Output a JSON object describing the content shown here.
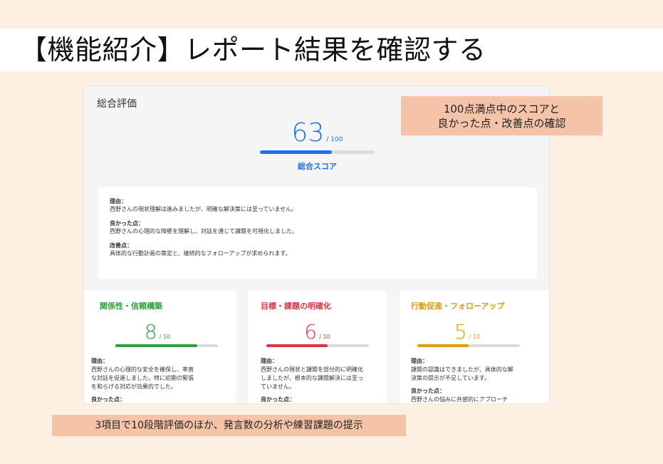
{
  "slide": {
    "title": "【機能紹介】レポート結果を確認する",
    "note_top_line1": "100点満点中のスコアと",
    "note_top_line2": "良かった点・改善点の確認",
    "note_bottom": "3項目で10段階評価のほか、発言数の分析や練習課題の提示"
  },
  "report": {
    "overall_label": "総合評価",
    "score": "63",
    "score_max": "/ 100",
    "score_fraction": 0.63,
    "score_caption": "総合スコア",
    "accent_color": "#1a73e8",
    "reason_heading": "理由：",
    "reason_text": "西野さんの現状理解は進みましたが、明確な解決策には至っていません。",
    "good_heading": "良かった点：",
    "good_text": "西野さんの心理的な障壁を理解し、対話を通じて課題を可視化しました。",
    "improve_heading": "改善点：",
    "improve_text": "具体的な行動計画の策定と、継続的なフォローアップが求められます。"
  },
  "categories": [
    {
      "title": "関係性・信頼構築",
      "score": "8",
      "max": "/ 10",
      "fraction": 0.8,
      "color": "#2e9e44",
      "reason_heading": "理由：",
      "reason_lines": [
        "西野さんの心理的な安全を確保し、率直",
        "な対話を促進しました。特に初期の緊張",
        "を和らげる対応が効果的でした。"
      ],
      "good_heading": "良かった点："
    },
    {
      "title": "目標・課題の明確化",
      "score": "6",
      "max": "/ 10",
      "fraction": 0.6,
      "color": "#d93545",
      "reason_heading": "理由：",
      "reason_lines": [
        "西野さんの現状と課題を部分的に明確化",
        "しましたが、根本的な課題解決には至っ",
        "ていません。"
      ],
      "good_heading": "良かった点："
    },
    {
      "title": "行動促進・フォローアップ",
      "score": "5",
      "max": "/ 10",
      "fraction": 0.5,
      "color": "#e09a0c",
      "reason_heading": "理由：",
      "reason_lines": [
        "課題の認識はできましたが、具体的な解",
        "決策の提示が不足しています。"
      ],
      "good_heading": "良かった点：",
      "good_lines": [
        "西野さんの悩みに共感的にアプローチ"
      ]
    }
  ]
}
